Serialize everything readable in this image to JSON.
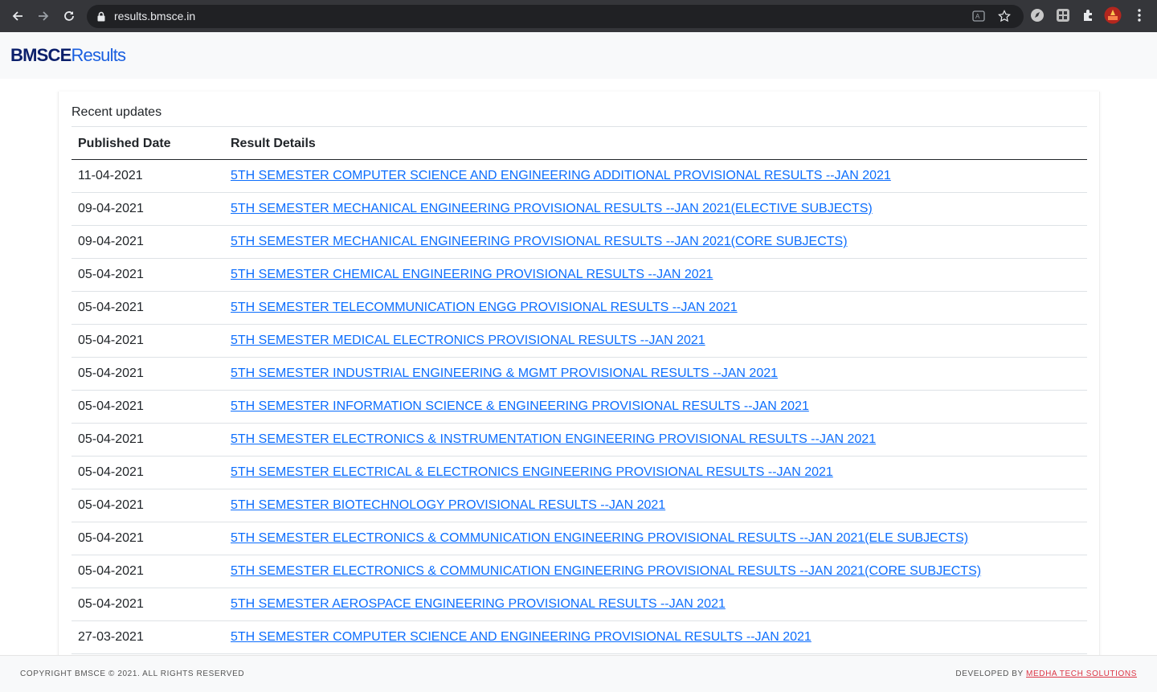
{
  "browser": {
    "url": "results.bmsce.in"
  },
  "header": {
    "brand_bold": "BMSCE",
    "brand_light": "Results"
  },
  "card": {
    "title": "Recent updates",
    "columns": [
      "Published Date",
      "Result Details"
    ],
    "rows": [
      {
        "date": "11-04-2021",
        "details": "5TH SEMESTER COMPUTER SCIENCE AND ENGINEERING ADDITIONAL PROVISIONAL RESULTS --JAN 2021"
      },
      {
        "date": "09-04-2021",
        "details": "5TH SEMESTER MECHANICAL ENGINEERING PROVISIONAL RESULTS --JAN 2021(ELECTIVE SUBJECTS)"
      },
      {
        "date": "09-04-2021",
        "details": "5TH SEMESTER MECHANICAL ENGINEERING PROVISIONAL RESULTS --JAN 2021(CORE SUBJECTS)"
      },
      {
        "date": "05-04-2021",
        "details": "5TH SEMESTER CHEMICAL ENGINEERING PROVISIONAL RESULTS --JAN 2021"
      },
      {
        "date": "05-04-2021",
        "details": "5TH SEMESTER TELECOMMUNICATION ENGG PROVISIONAL RESULTS --JAN 2021"
      },
      {
        "date": "05-04-2021",
        "details": "5TH SEMESTER MEDICAL ELECTRONICS PROVISIONAL RESULTS --JAN 2021"
      },
      {
        "date": "05-04-2021",
        "details": "5TH SEMESTER INDUSTRIAL ENGINEERING & MGMT PROVISIONAL RESULTS --JAN 2021"
      },
      {
        "date": "05-04-2021",
        "details": "5TH SEMESTER INFORMATION SCIENCE & ENGINEERING PROVISIONAL RESULTS --JAN 2021"
      },
      {
        "date": "05-04-2021",
        "details": "5TH SEMESTER ELECTRONICS & INSTRUMENTATION ENGINEERING PROVISIONAL RESULTS --JAN 2021"
      },
      {
        "date": "05-04-2021",
        "details": "5TH SEMESTER ELECTRICAL & ELECTRONICS ENGINEERING PROVISIONAL RESULTS --JAN 2021"
      },
      {
        "date": "05-04-2021",
        "details": "5TH SEMESTER BIOTECHNOLOGY PROVISIONAL RESULTS --JAN 2021"
      },
      {
        "date": "05-04-2021",
        "details": "5TH SEMESTER ELECTRONICS & COMMUNICATION ENGINEERING PROVISIONAL RESULTS --JAN 2021(ELE SUBJECTS)"
      },
      {
        "date": "05-04-2021",
        "details": "5TH SEMESTER ELECTRONICS & COMMUNICATION ENGINEERING PROVISIONAL RESULTS --JAN 2021(CORE SUBJECTS)"
      },
      {
        "date": "05-04-2021",
        "details": "5TH SEMESTER AEROSPACE ENGINEERING PROVISIONAL RESULTS --JAN 2021"
      },
      {
        "date": "27-03-2021",
        "details": "5TH SEMESTER COMPUTER SCIENCE AND ENGINEERING PROVISIONAL RESULTS --JAN 2021"
      }
    ]
  },
  "footer": {
    "copyright": "COPYRIGHT BMSCE © 2021. ALL RIGHTS RESERVED",
    "developed_by": "DEVELOPED BY",
    "developer": "MEDHA TECH SOLUTIONS"
  },
  "colors": {
    "link": "#0d6efd",
    "brand_dark": "#0b1f6b",
    "brand_accent": "#1a5fe0",
    "footer_link": "#dc3545"
  }
}
